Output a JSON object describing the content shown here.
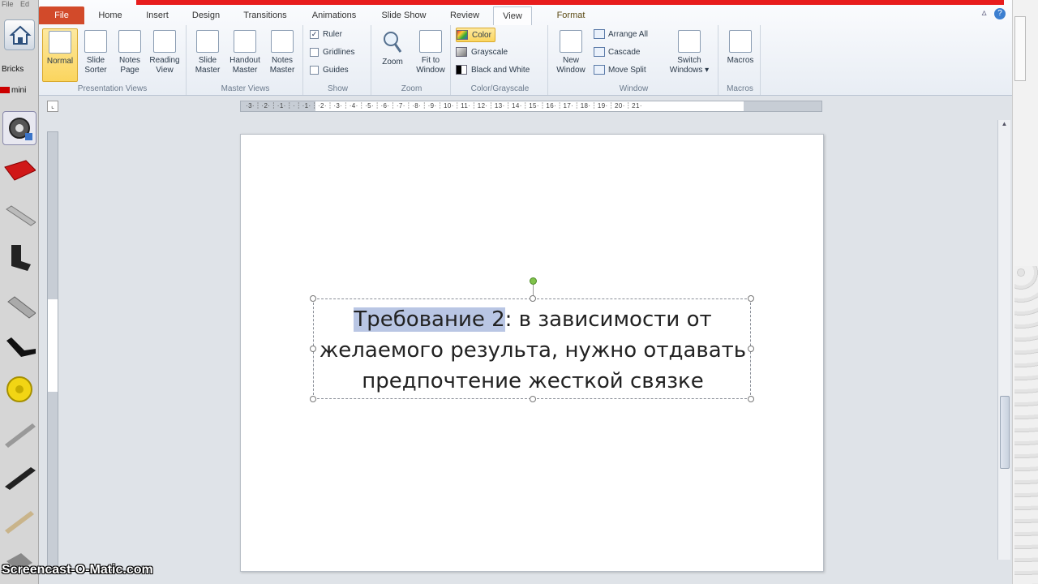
{
  "left_app": {
    "menu": [
      "File",
      "Ed"
    ],
    "bricks_label": "Bricks",
    "mini_label": "mini"
  },
  "ribbon": {
    "tabs": [
      "File",
      "Home",
      "Insert",
      "Design",
      "Transitions",
      "Animations",
      "Slide Show",
      "Review",
      "View",
      "Format"
    ],
    "active_tab": "View",
    "groups": {
      "presentation_views": {
        "label": "Presentation Views",
        "buttons": [
          {
            "line1": "Normal",
            "line2": ""
          },
          {
            "line1": "Slide",
            "line2": "Sorter"
          },
          {
            "line1": "Notes",
            "line2": "Page"
          },
          {
            "line1": "Reading",
            "line2": "View"
          }
        ]
      },
      "master_views": {
        "label": "Master Views",
        "buttons": [
          {
            "line1": "Slide",
            "line2": "Master"
          },
          {
            "line1": "Handout",
            "line2": "Master"
          },
          {
            "line1": "Notes",
            "line2": "Master"
          }
        ]
      },
      "show": {
        "label": "Show",
        "ruler": "Ruler",
        "gridlines": "Gridlines",
        "guides": "Guides"
      },
      "zoom": {
        "label": "Zoom",
        "zoom": "Zoom",
        "fit_line1": "Fit to",
        "fit_line2": "Window"
      },
      "color": {
        "label": "Color/Grayscale",
        "color": "Color",
        "grayscale": "Grayscale",
        "bw": "Black and White"
      },
      "window": {
        "label": "Window",
        "new_line1": "New",
        "new_line2": "Window",
        "arrange": "Arrange All",
        "cascade": "Cascade",
        "move_split": "Move Split",
        "switch_line1": "Switch",
        "switch_line2": "Windows"
      },
      "macros": {
        "label": "Macros",
        "macros": "Macros"
      }
    }
  },
  "ruler": {
    "h_numbers": "·3·︙·2·︙·1·︙·︙·1·︙·2·︙·3·︙·4·︙·5·︙·6·︙·7·︙·8·︙·9·︙10·︙11·︙12·︙13·︙14·︙15·︙16·︙17·︙18·︙19·︙20·︙21·"
  },
  "slide": {
    "text_highlight": "Требование 2",
    "text_rest_line1": ": в зависимости от",
    "text_line2": "желаемого результа, нужно отдавать",
    "text_line3": "предпочтение жесткой связке"
  },
  "watermark": "Screencast-O-Matic.com",
  "colors": {
    "file_tab": "#d24a2a",
    "top_bar": "#e81d1d",
    "selection": "#b9c6e4"
  }
}
